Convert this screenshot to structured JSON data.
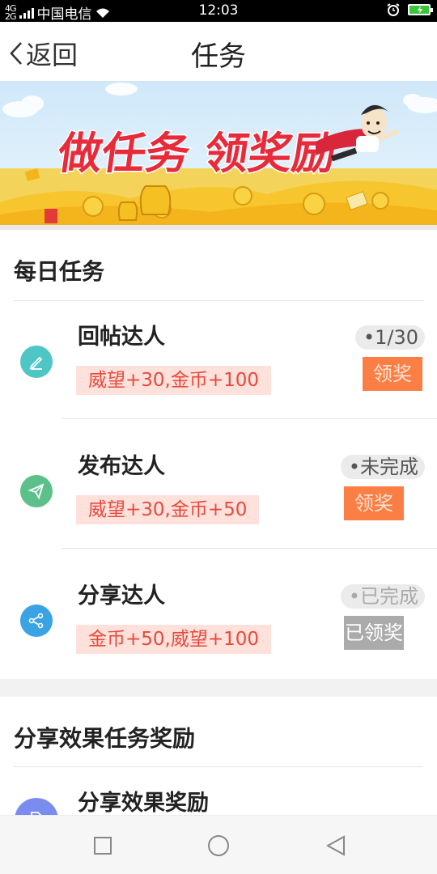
{
  "status_bar": {
    "signal_label": "4G\n2G",
    "carrier": "中国电信",
    "time": "12:03",
    "icons": [
      "signal-icon",
      "wifi-icon",
      "alarm-icon",
      "battery-charging-icon"
    ]
  },
  "header": {
    "back_label": "返回",
    "title": "任务"
  },
  "banner": {
    "headline": "做任务 领奖励"
  },
  "daily": {
    "title": "每日任务",
    "tasks": [
      {
        "name": "回帖达人",
        "reward": "威望+30,金币+100",
        "status": "•1/30",
        "button": "领奖",
        "icon": "pencil-icon",
        "color": "#4ec6c6"
      },
      {
        "name": "发布达人",
        "reward": "威望+30,金币+50",
        "status": "•未完成",
        "button": "领奖",
        "icon": "paper-plane-icon",
        "color": "#5cc08a"
      },
      {
        "name": "分享达人",
        "reward": "金币+50,威望+100",
        "status": "•已完成",
        "button": "已领奖",
        "icon": "share-icon",
        "color": "#3aa3e3"
      }
    ]
  },
  "share_effect": {
    "title": "分享效果任务奖励",
    "tasks": [
      {
        "name": "分享效果奖励",
        "icon": "document-icon",
        "color": "#7b8cf0"
      }
    ]
  },
  "colors": {
    "claim_button": "#fb7f45",
    "claimed_button": "#ababab",
    "reward_bg": "#fde1da",
    "reward_text": "#e8493e"
  }
}
